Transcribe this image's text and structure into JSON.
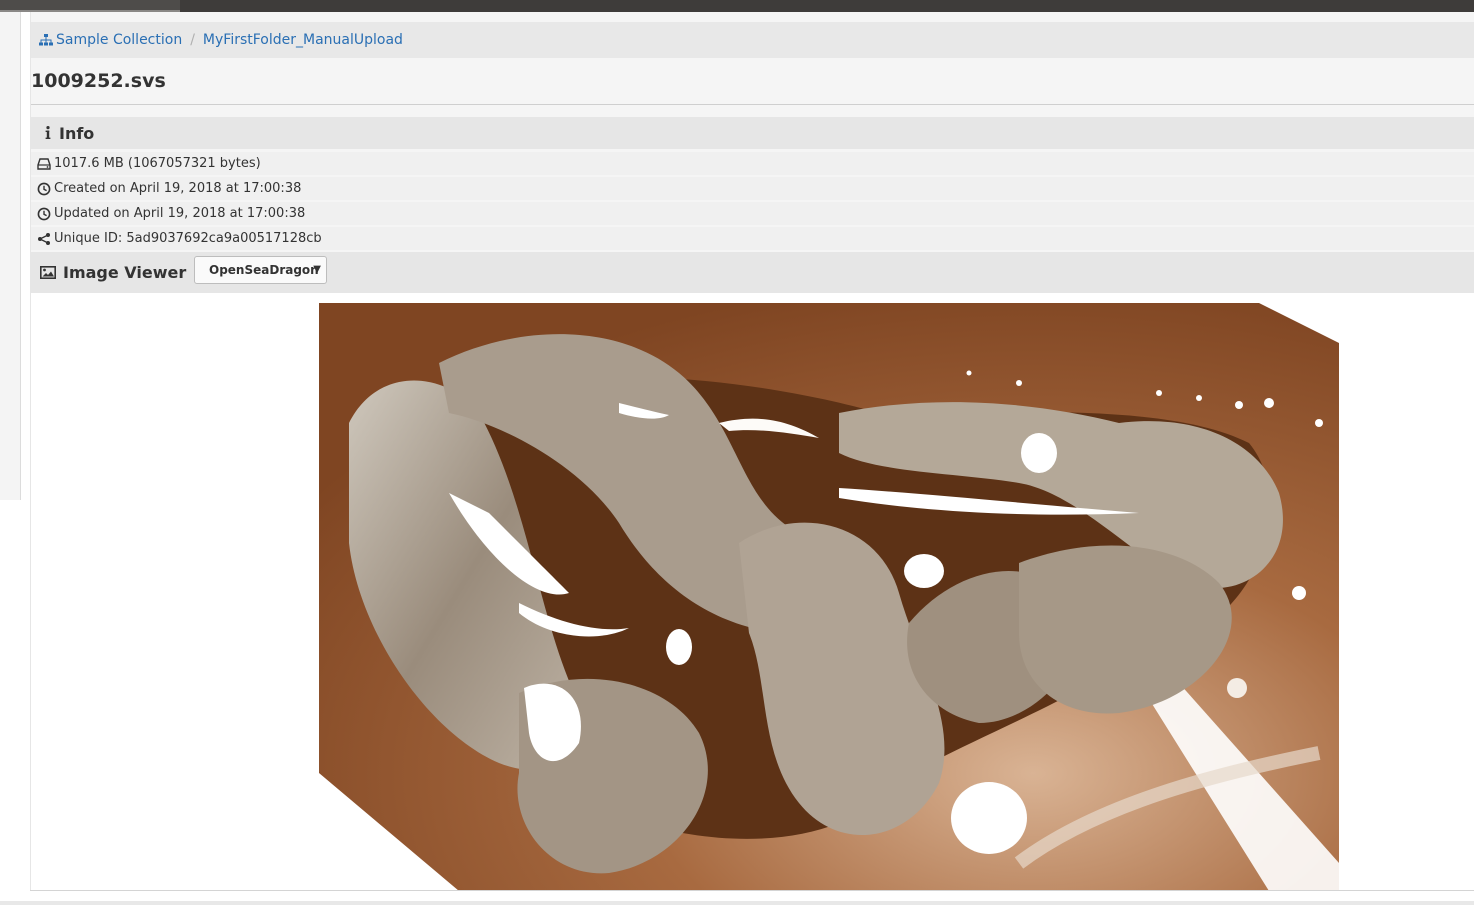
{
  "breadcrumb": {
    "items": [
      {
        "label": "Sample Collection"
      },
      {
        "label": "MyFirstFolder_ManualUpload"
      }
    ]
  },
  "page": {
    "title": "1009252.svs"
  },
  "info": {
    "heading": "Info",
    "size": "1017.6 MB (1067057321 bytes)",
    "created": "Created on April 19, 2018 at 17:00:38",
    "updated": "Updated on April 19, 2018 at 17:00:38",
    "unique_id": "Unique ID: 5ad9037692ca9a00517128cb"
  },
  "viewer": {
    "heading": "Image Viewer",
    "selected": "OpenSeaDragon"
  },
  "icons": {
    "breadcrumb": "sitemap-icon",
    "info": "info-icon",
    "size": "hdd-icon",
    "created": "clock-icon",
    "updated": "clock-icon",
    "unique_id": "share-icon",
    "viewer": "image-icon",
    "select": "caret-down-icon"
  },
  "colors": {
    "link": "#2a6fb4",
    "panel_header": "#e6e6e6",
    "topbar": "#3e3c3a",
    "stain": "#7a4422"
  }
}
